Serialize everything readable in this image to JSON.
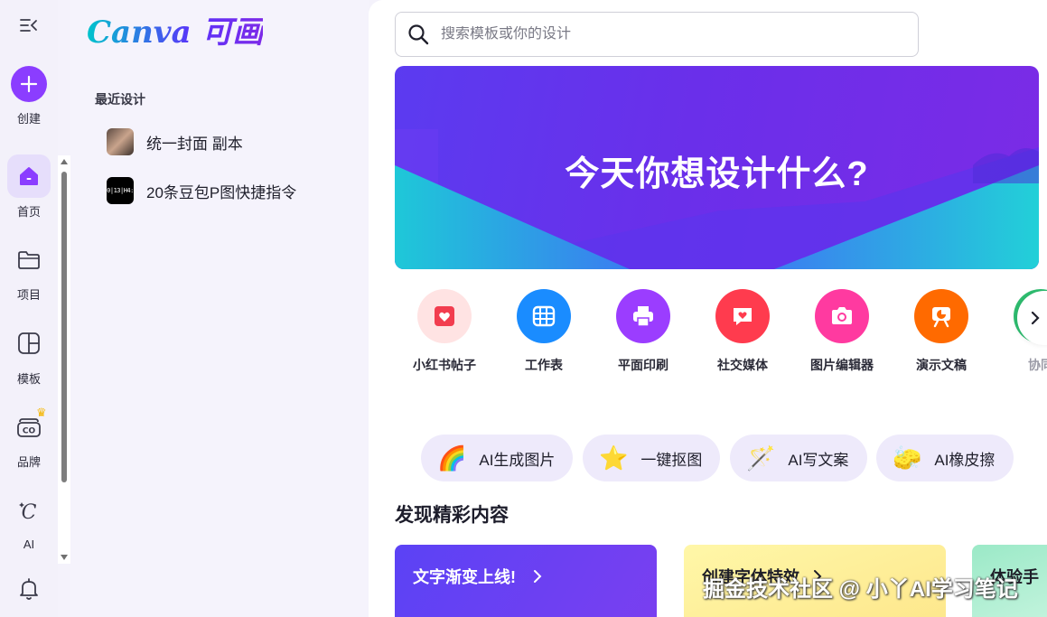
{
  "rail": {
    "create_label": "创建",
    "items": [
      {
        "label": "首页",
        "icon": "home-icon",
        "active": true
      },
      {
        "label": "项目",
        "icon": "folder-icon",
        "active": false
      },
      {
        "label": "模板",
        "icon": "templates-icon",
        "active": false
      },
      {
        "label": "品牌",
        "icon": "brand-icon",
        "active": false
      },
      {
        "label": "AI",
        "icon": "ai-icon",
        "active": false
      }
    ]
  },
  "panel": {
    "logo_text": "Canva 可画",
    "recent_title": "最近设计",
    "recent_items": [
      {
        "label": "统一封面 副本",
        "thumb": "photo"
      },
      {
        "label": "20条豆包P图快捷指令",
        "thumb": "black",
        "thumb_text": "0|13|H4:"
      }
    ]
  },
  "search": {
    "placeholder": "搜索模板或你的设计"
  },
  "hero": {
    "title": "今天你想设计什么?"
  },
  "categories": [
    {
      "label": "小红书帖子",
      "icon": "heart-card-icon",
      "color": "#ffe3e3",
      "fg": "#f23d4f"
    },
    {
      "label": "工作表",
      "icon": "table-icon",
      "color": "#1a8cff",
      "fg": "#ffffff"
    },
    {
      "label": "平面印刷",
      "icon": "printer-icon",
      "color": "#9b3dff",
      "fg": "#ffffff"
    },
    {
      "label": "社交媒体",
      "icon": "chat-heart-icon",
      "color": "#ff3b4e",
      "fg": "#ffffff"
    },
    {
      "label": "图片编辑器",
      "icon": "camera-icon",
      "color": "#ff3aa0",
      "fg": "#ffffff"
    },
    {
      "label": "演示文稿",
      "icon": "presentation-icon",
      "color": "#ff6a00",
      "fg": "#ffffff"
    },
    {
      "label": "协同",
      "icon": "collab-icon",
      "color": "#2fbf71",
      "fg": "#ffffff"
    }
  ],
  "ai_tools": [
    {
      "label": "AI生成图片",
      "icon": "rainbow-icon",
      "glyph": "🌈"
    },
    {
      "label": "一键抠图",
      "icon": "star-icon",
      "glyph": "⭐"
    },
    {
      "label": "AI写文案",
      "icon": "magic-wand-icon",
      "glyph": "🪄"
    },
    {
      "label": "AI橡皮擦",
      "icon": "eraser-icon",
      "glyph": "🧽"
    }
  ],
  "discover": {
    "title": "发现精彩内容",
    "cards": [
      {
        "label": "文字渐变上线!"
      },
      {
        "label": "创建字体特效"
      },
      {
        "label": "体验手"
      }
    ]
  },
  "watermark": "掘金技术社区 @ 小丫AI学习笔记"
}
